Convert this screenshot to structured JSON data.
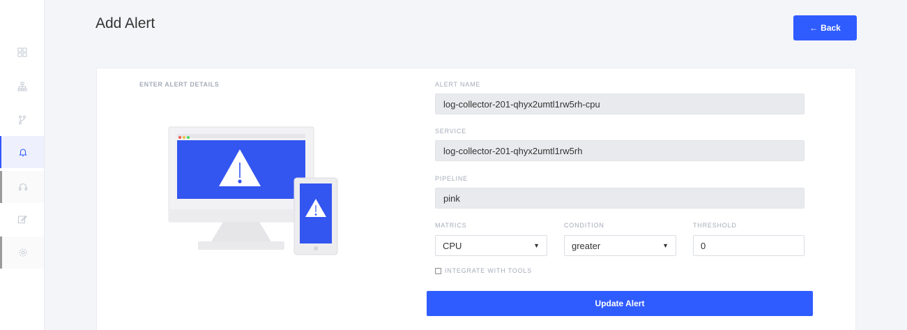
{
  "header": {
    "title": "Add Alert",
    "back_label": "Back"
  },
  "sidebar": {
    "items": [
      {
        "icon": "dashboard-icon",
        "state": "normal"
      },
      {
        "icon": "org-chart-icon",
        "state": "normal"
      },
      {
        "icon": "branch-icon",
        "state": "normal"
      },
      {
        "icon": "bell-icon",
        "state": "active"
      },
      {
        "icon": "headset-icon",
        "state": "normal"
      },
      {
        "icon": "edit-icon",
        "state": "normal"
      },
      {
        "icon": "settings-icon",
        "state": "normal"
      }
    ]
  },
  "form": {
    "section_label": "ENTER ALERT DETAILS",
    "alert_name": {
      "label": "ALERT NAME",
      "value": "log-collector-201-qhyx2umtl1rw5rh-cpu"
    },
    "service": {
      "label": "SERVICE",
      "value": "log-collector-201-qhyx2umtl1rw5rh"
    },
    "pipeline": {
      "label": "PIPELINE",
      "value": "pink"
    },
    "metrics": {
      "label": "MATRICS",
      "value": "CPU"
    },
    "condition": {
      "label": "CONDITION",
      "value": "greater"
    },
    "threshold": {
      "label": "THRESHOLD",
      "value": "0"
    },
    "integrate": {
      "label": "INTEGRATE WITH TOOLS",
      "checked": false
    },
    "submit_label": "Update Alert"
  },
  "colors": {
    "accent": "#2f5cff",
    "sidebar_active_bg": "#eef1fd"
  }
}
